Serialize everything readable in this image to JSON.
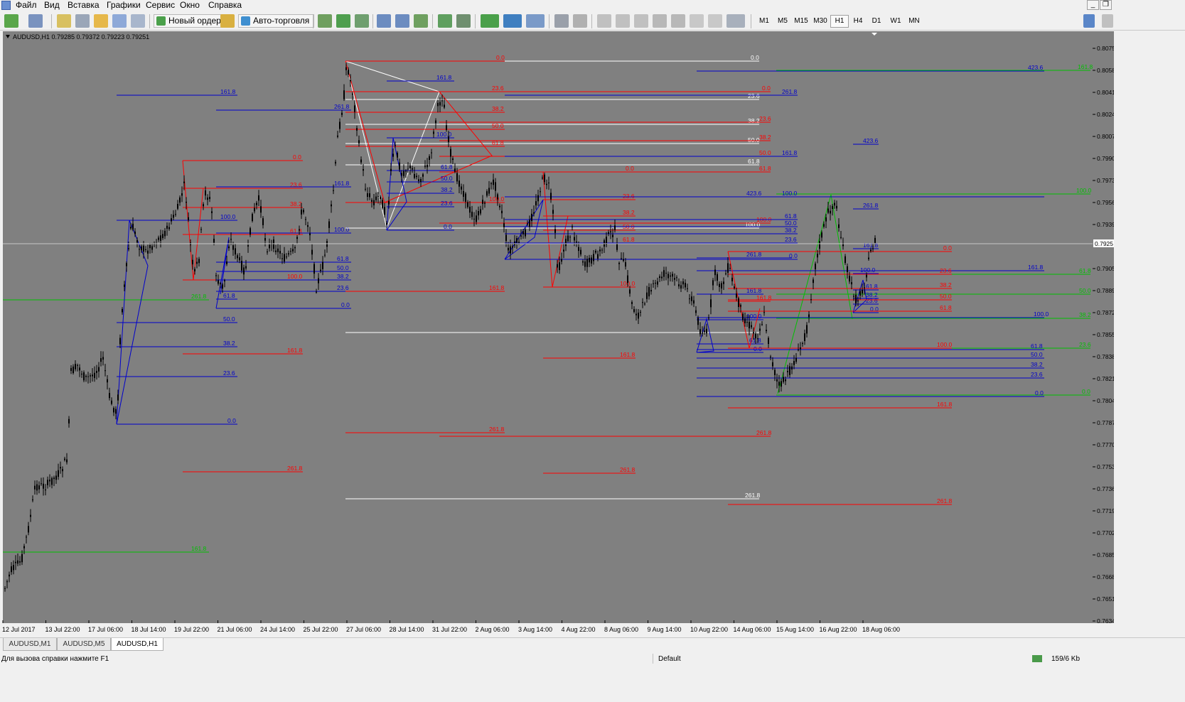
{
  "menu": {
    "items": [
      "Файл",
      "Вид",
      "Вставка",
      "Графики",
      "Сервис",
      "Окно",
      "Справка"
    ]
  },
  "toolbar": {
    "new_order": "Новый ордер",
    "autotrading": "Авто-торговля",
    "timeframes": [
      "M1",
      "M5",
      "M15",
      "M30",
      "H1",
      "H4",
      "D1",
      "W1",
      "MN"
    ],
    "active_timeframe": "H1"
  },
  "chart": {
    "header": "AUDUSD,H1  0.79285 0.79372 0.79223 0.79251",
    "current_price": "0.7925",
    "colors": {
      "background": "#808080",
      "candles": "#000000",
      "fib_red": "#ff0000",
      "fib_blue": "#0000cc",
      "fib_white": "#ffffff",
      "fib_green": "#00c000",
      "bid_line": "#c0c0c0"
    },
    "price_ticks": [
      "0.8075",
      "0.8058",
      "0.8041",
      "0.8024",
      "0.8007",
      "0.7990",
      "0.7973",
      "0.7956",
      "0.7939",
      "0.7925",
      "0.7905",
      "0.7889",
      "0.7872",
      "0.7855",
      "0.7838",
      "0.7821",
      "0.7804",
      "0.7787",
      "0.7770",
      "0.7753",
      "0.7736",
      "0.7719",
      "0.7702",
      "0.7685",
      "0.7668",
      "0.7651",
      "0.7634"
    ],
    "time_ticks": [
      "12 Jul 2017",
      "13 Jul 22:00",
      "17 Jul 06:00",
      "18 Jul 14:00",
      "19 Jul 22:00",
      "21 Jul 06:00",
      "24 Jul 14:00",
      "25 Jul 22:00",
      "27 Jul 06:00",
      "28 Jul 14:00",
      "31 Jul 22:00",
      "2 Aug 06:00",
      "3 Aug 14:00",
      "4 Aug 22:00",
      "8 Aug 06:00",
      "9 Aug 14:00",
      "10 Aug 22:00",
      "14 Aug 06:00",
      "15 Aug 14:00",
      "16 Aug 22:00",
      "18 Aug 06:00"
    ]
  },
  "tabs": [
    "AUDUSD,M1",
    "AUDUSD,M5",
    "AUDUSD,H1"
  ],
  "active_tab": "AUDUSD,H1",
  "status": {
    "help": "Для вызова справки нажмите F1",
    "profile": "Default",
    "traffic": "159/6 Kb"
  }
}
